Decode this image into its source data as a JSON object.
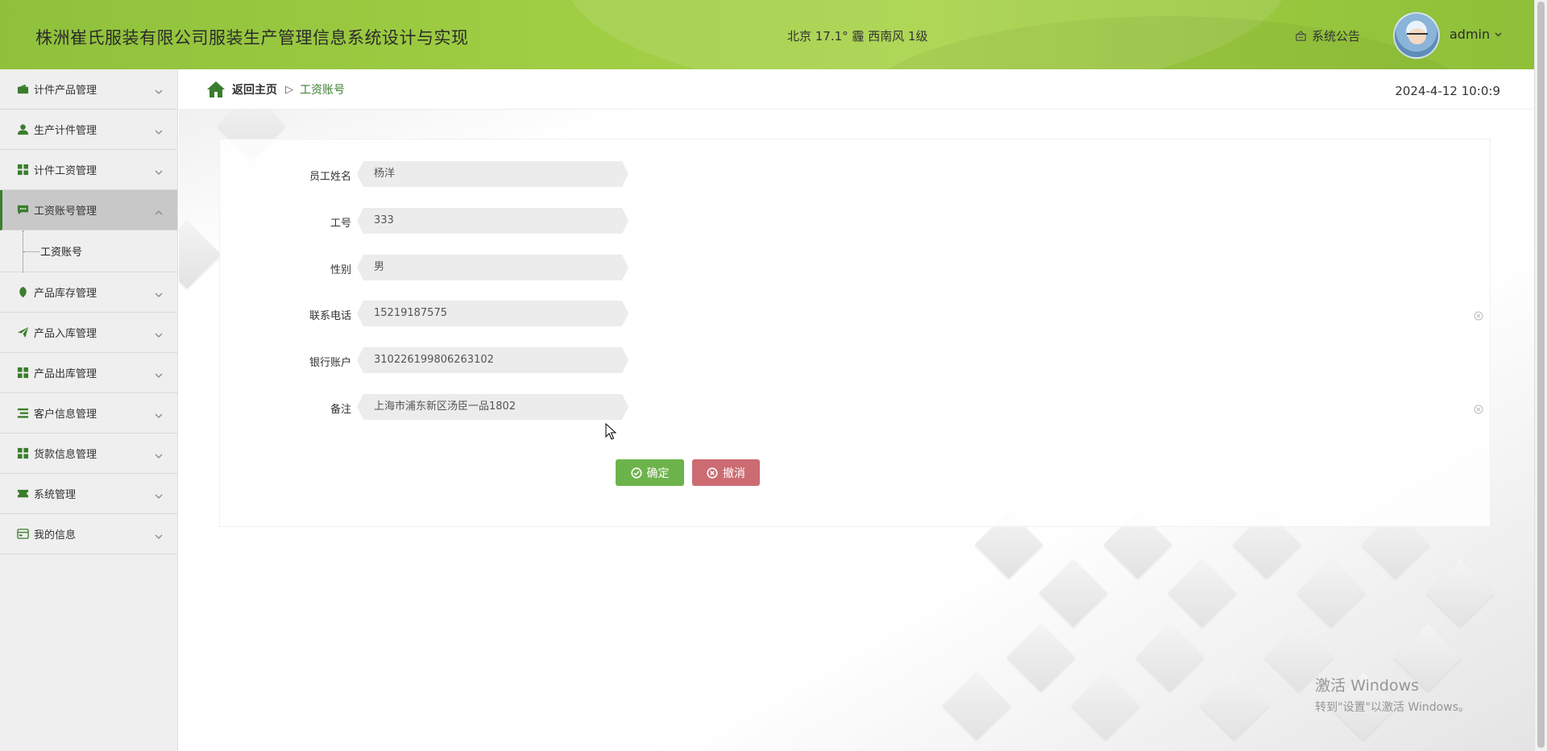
{
  "header": {
    "title": "株洲崔氏服装有限公司服装生产管理信息系统设计与实现",
    "weather": "北京  17.1°  霾  西南风  1级",
    "notice_label": "系统公告",
    "username": "admin",
    "menu_caret": "⌄"
  },
  "sidebar": {
    "items": [
      {
        "label": "计件产品管理",
        "icon": "wallet-icon"
      },
      {
        "label": "生产计件管理",
        "icon": "person-icon"
      },
      {
        "label": "计件工资管理",
        "icon": "grid-icon"
      },
      {
        "label": "工资账号管理",
        "icon": "chat-icon",
        "expanded": true
      },
      {
        "label": "产品库存管理",
        "icon": "leaf-icon"
      },
      {
        "label": "产品入库管理",
        "icon": "send-icon"
      },
      {
        "label": "产品出库管理",
        "icon": "grid-icon"
      },
      {
        "label": "客户信息管理",
        "icon": "list-icon"
      },
      {
        "label": "货款信息管理",
        "icon": "grid-icon"
      },
      {
        "label": "系统管理",
        "icon": "ticket-icon"
      },
      {
        "label": "我的信息",
        "icon": "card-icon"
      }
    ],
    "sub_items": [
      {
        "label": "工资账号"
      }
    ]
  },
  "breadcrumb": {
    "home": "返回主页",
    "separator": "▷",
    "current": "工资账号"
  },
  "clock": "2024-4-12 10:0:9",
  "form": {
    "fields": [
      {
        "label": "员工姓名",
        "value": "杨洋"
      },
      {
        "label": "工号",
        "value": "333"
      },
      {
        "label": "性别",
        "value": "男"
      },
      {
        "label": "联系电话",
        "value": "15219187575"
      },
      {
        "label": "银行账户",
        "value": "310226199806263102"
      },
      {
        "label": "备注",
        "value": "上海市浦东新区汤臣一品1802"
      }
    ],
    "confirm_label": "确定",
    "cancel_label": "撤消"
  },
  "watermark": {
    "line1": "激活 Windows",
    "line2": "转到\"设置\"以激活 Windows。"
  },
  "colors": {
    "header_green": "#9fcd43",
    "accent_green": "#3a7d2c",
    "confirm_green": "#6db34b",
    "cancel_red": "#cc6b72"
  }
}
